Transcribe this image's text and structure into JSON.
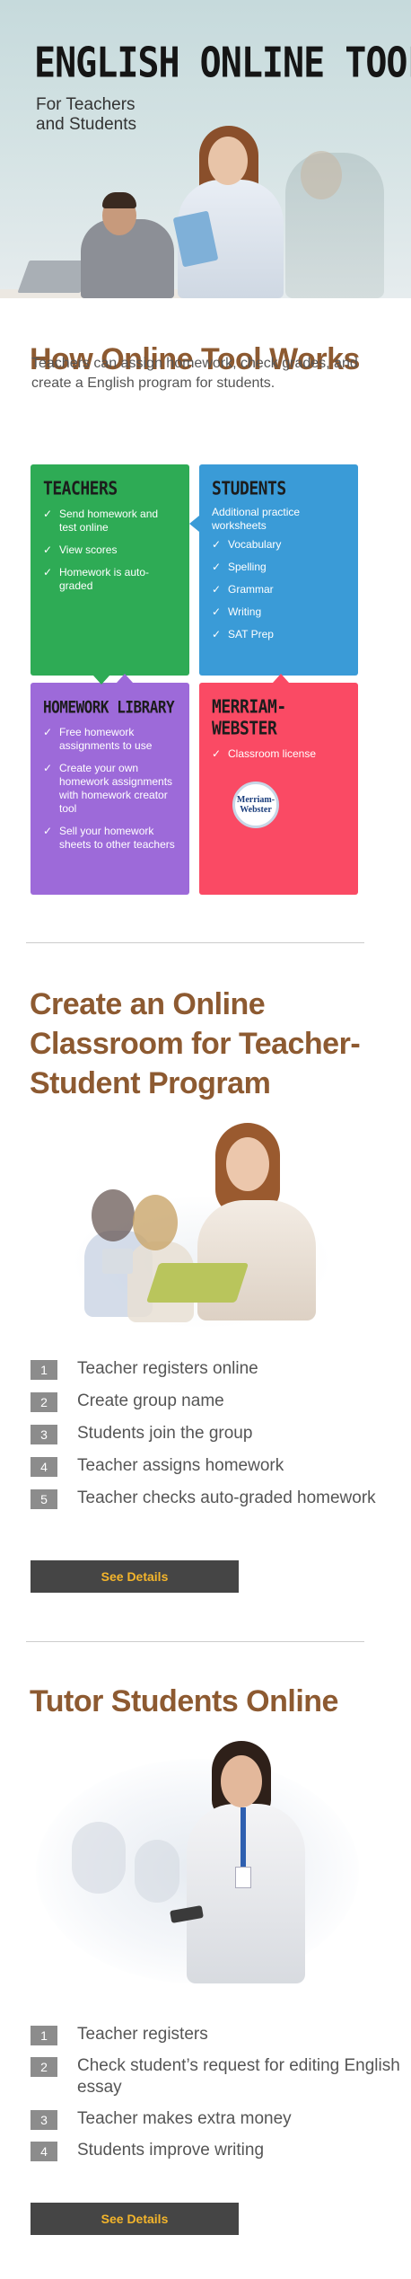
{
  "hero": {
    "title": "ENGLISH ONLINE TOOL",
    "subtitle_line1": "For Teachers",
    "subtitle_line2": "and Students"
  },
  "how_it_works": {
    "heading": "How Online Tool Works",
    "intro": "Teachers can assign homework, check grades, and create a English program for students.",
    "cards": {
      "teachers": {
        "title": "TEACHERS",
        "items": [
          "Send homework and test online",
          "View scores",
          "Homework is auto-graded"
        ],
        "color": "#2eab55"
      },
      "students": {
        "title": "STUDENTS",
        "note": "Additional practice worksheets",
        "items": [
          "Vocabulary",
          "Spelling",
          "Grammar",
          "Writing",
          "SAT Prep"
        ],
        "color": "#3a9bd7"
      },
      "library": {
        "title": "HOMEWORK LIBRARY",
        "items": [
          "Free homework assignments to use",
          "Create your own homework assignments with homework creator tool",
          "Sell your homework sheets to other teachers"
        ],
        "color": "#9d6ad9"
      },
      "merriam": {
        "title_line1": "MERRIAM-",
        "title_line2": "WEBSTER",
        "items": [
          "Classroom license"
        ],
        "logo_line1": "Merriam-",
        "logo_line2": "Webster",
        "color": "#fa4a64"
      }
    }
  },
  "classroom": {
    "heading_line1": "Create an Online",
    "heading_line2": "Classroom for Teacher-",
    "heading_line3": "Student Program",
    "steps": [
      {
        "num": "1",
        "text": "Teacher registers online"
      },
      {
        "num": "2",
        "text": "Create group name"
      },
      {
        "num": "3",
        "text": "Students join the group"
      },
      {
        "num": "4",
        "text": "Teacher assigns homework"
      },
      {
        "num": "5",
        "text": "Teacher checks auto-graded homework"
      }
    ],
    "button": "See Details"
  },
  "tutor": {
    "heading": "Tutor Students Online",
    "steps": [
      {
        "num": "1",
        "text": "Teacher registers"
      },
      {
        "num": "2",
        "text": "Check student’s request for editing English essay"
      },
      {
        "num": "3",
        "text": "Teacher makes extra money"
      },
      {
        "num": "4",
        "text": "Students improve writing"
      }
    ],
    "button": "See Details"
  },
  "colors": {
    "heading": "#8d5a31",
    "button_bg": "#454545",
    "button_text": "#f4b52b"
  }
}
